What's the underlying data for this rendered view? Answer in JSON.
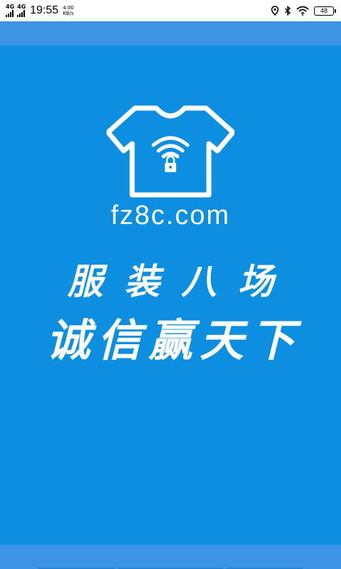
{
  "status_bar": {
    "network1": "4G",
    "network2": "4G",
    "time": "19:55",
    "speed_value": "4.00",
    "speed_unit": "KB/s",
    "battery": "48",
    "icons": [
      "location-icon",
      "bluetooth-icon",
      "wifi-icon",
      "battery-icon"
    ]
  },
  "splash": {
    "logo_icon": "tshirt-wifi-lock-icon",
    "domain": "fz8c.com",
    "slogan_line1": "服装八场",
    "slogan_line2": "诚信赢天下"
  },
  "colors": {
    "background": "#0c8fe0",
    "bars": "#3b95e4",
    "logo": "#ffffff"
  }
}
